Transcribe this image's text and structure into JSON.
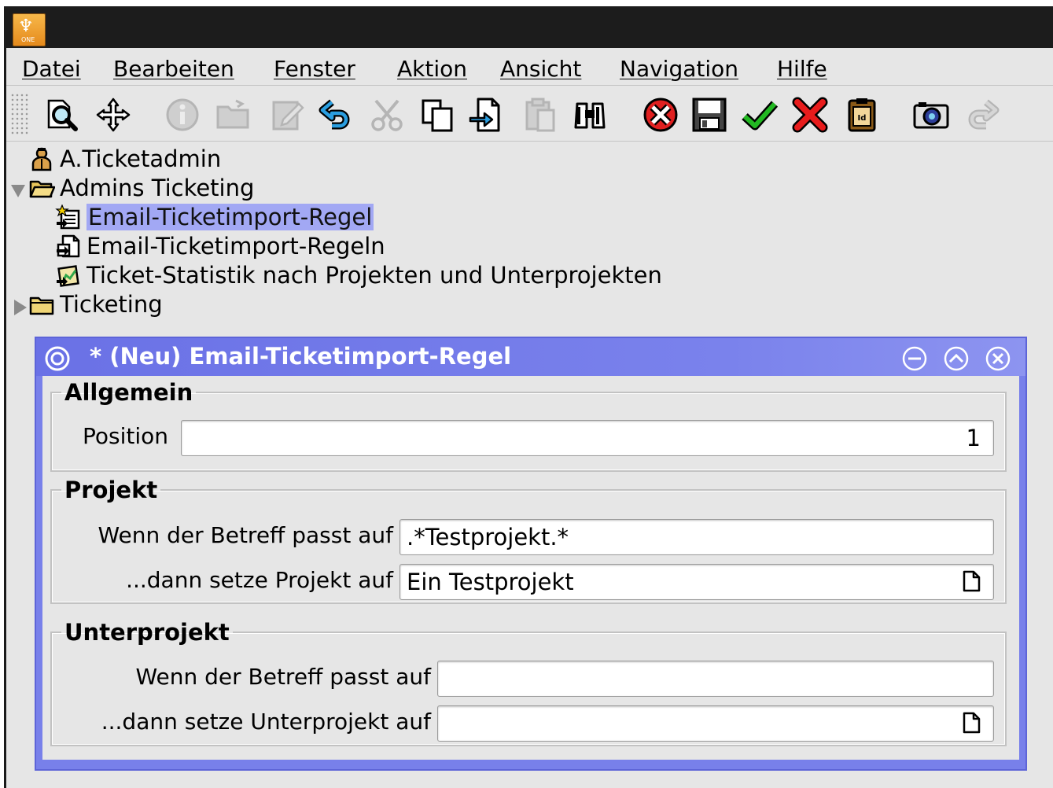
{
  "app": {
    "icon": "app-logo-icon",
    "icon_text": "ONE"
  },
  "menu": [
    {
      "label": "Datei"
    },
    {
      "label": "Bearbeiten"
    },
    {
      "label": "Fenster"
    },
    {
      "label": "Aktion"
    },
    {
      "label": "Ansicht"
    },
    {
      "label": "Navigation"
    },
    {
      "label": "Hilfe"
    }
  ],
  "toolbar": [
    {
      "icon": "search-zoom-icon",
      "enabled": true
    },
    {
      "icon": "navigate-icon",
      "enabled": true
    },
    {
      "icon": "info-icon",
      "enabled": false
    },
    {
      "icon": "folder-icon",
      "enabled": false
    },
    {
      "icon": "edit-icon",
      "enabled": false
    },
    {
      "icon": "undo-icon",
      "enabled": true
    },
    {
      "icon": "cut-icon",
      "enabled": false
    },
    {
      "icon": "copy-icon",
      "enabled": true
    },
    {
      "icon": "paste-into-icon",
      "enabled": true
    },
    {
      "icon": "paste-icon",
      "enabled": false
    },
    {
      "icon": "find-binoculars-icon",
      "enabled": true
    },
    {
      "icon": "cancel-icon",
      "enabled": true
    },
    {
      "icon": "save-icon",
      "enabled": true
    },
    {
      "icon": "confirm-check-icon",
      "enabled": true
    },
    {
      "icon": "delete-x-icon",
      "enabled": true
    },
    {
      "icon": "id-clipboard-icon",
      "enabled": true
    },
    {
      "icon": "camera-icon",
      "enabled": true
    },
    {
      "icon": "redo-icon",
      "enabled": false
    }
  ],
  "tree": [
    {
      "label": "A.Ticketadmin",
      "icon": "user-icon",
      "level": 0,
      "expander": ""
    },
    {
      "label": "Admins Ticketing",
      "icon": "folder-open-icon",
      "level": 0,
      "expander": "expanded"
    },
    {
      "label": "Email-Ticketimport-Regel",
      "icon": "new-form-icon",
      "level": 1,
      "selected": true
    },
    {
      "label": "Email-Ticketimport-Regeln",
      "icon": "form-list-icon",
      "level": 1
    },
    {
      "label": "Ticket-Statistik nach Projekten und Unterprojekten",
      "icon": "report-icon",
      "level": 1
    },
    {
      "label": "Ticketing",
      "icon": "folder-icon",
      "level": 0,
      "expander": "collapsed"
    }
  ],
  "frame": {
    "title": "* (Neu) Email-Ticketimport-Regel",
    "colors": {
      "titlebar": "#6a71e6",
      "border": "#7880ea",
      "selection": "#a2a8f4"
    },
    "buttons": [
      {
        "icon": "minimize-icon"
      },
      {
        "icon": "maximize-icon"
      },
      {
        "icon": "close-icon"
      }
    ],
    "groups": {
      "allgemein": {
        "title": "Allgemein",
        "position_label": "Position",
        "position_value": "1"
      },
      "projekt": {
        "title": "Projekt",
        "subject_label": "Wenn der Betreff passt auf",
        "subject_value": ".*Testprojekt.*",
        "set_label": "...dann setze Projekt auf",
        "set_value": "Ein Testprojekt"
      },
      "unterprojekt": {
        "title": "Unterprojekt",
        "subject_label": "Wenn der Betreff passt auf",
        "subject_value": "",
        "set_label": "...dann setze Unterprojekt auf",
        "set_value": ""
      }
    }
  }
}
